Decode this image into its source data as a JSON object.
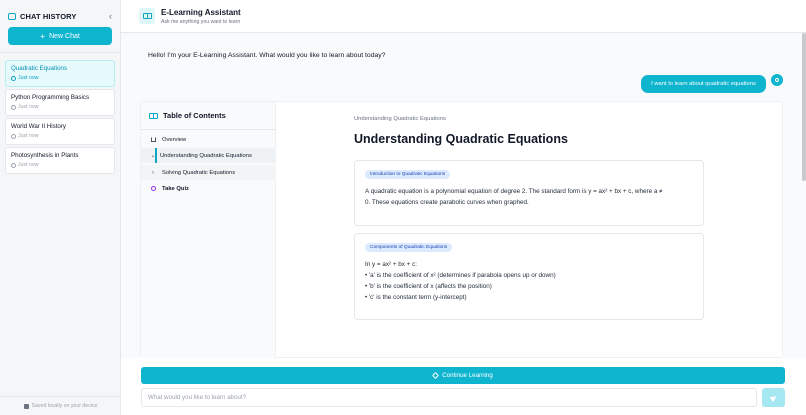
{
  "sidebar": {
    "title": "CHAT HISTORY",
    "collapse_icon": "chevron-left-icon",
    "new_chat_label": "New Chat",
    "items": [
      {
        "title": "Quadratic Equations",
        "time": "Just now",
        "active": true
      },
      {
        "title": "Python Programming Basics",
        "time": "Just now",
        "active": false
      },
      {
        "title": "World War II History",
        "time": "Just now",
        "active": false
      },
      {
        "title": "Photosynthesis in Plants",
        "time": "Just now",
        "active": false
      }
    ],
    "footer": "Saved locally on your device"
  },
  "header": {
    "title": "E-Learning Assistant",
    "subtitle": "Ask me anything you want to learn"
  },
  "chat": {
    "assistant_message": "Hello! I'm your E-Learning Assistant. What would you like to learn about today?",
    "user_message": "I want to learn about quadratic equations"
  },
  "toc": {
    "title": "Table of Contents",
    "items": [
      {
        "label": "Overview",
        "icon": "home-icon"
      },
      {
        "label": "Understanding Quadratic Equations",
        "icon": "chevron-down-icon"
      },
      {
        "label": "Solving Quadratic Equations",
        "icon": "chevron-right-icon"
      },
      {
        "label": "Take Quiz",
        "icon": "quiz-icon"
      }
    ]
  },
  "content": {
    "breadcrumb": "Understanding Quadratic Equations",
    "title": "Understanding Quadratic Equations",
    "cards": [
      {
        "badge": "Introduction to Quadratic Equations",
        "lines": [
          "A quadratic equation is a polynomial equation of degree 2. The standard form is y = ax² + bx + c, where a ≠",
          "0. These equations create parabolic curves when graphed."
        ]
      },
      {
        "badge": "Components of Quadratic Equations",
        "lines": [
          "In y = ax² + bx + c:",
          "• 'a' is the coefficient of x² (determines if parabola opens up or down)",
          "• 'b' is the coefficient of x (affects the position)",
          "• 'c' is the constant term (y-intercept)"
        ]
      }
    ]
  },
  "footer": {
    "continue_label": "Continue Learning",
    "input_placeholder": "What would you like to learn about?"
  },
  "colors": {
    "accent": "#0fb5cf",
    "accent_light": "#a5e8f2",
    "badge_bg": "#dbeafe",
    "badge_text": "#1e40af"
  }
}
